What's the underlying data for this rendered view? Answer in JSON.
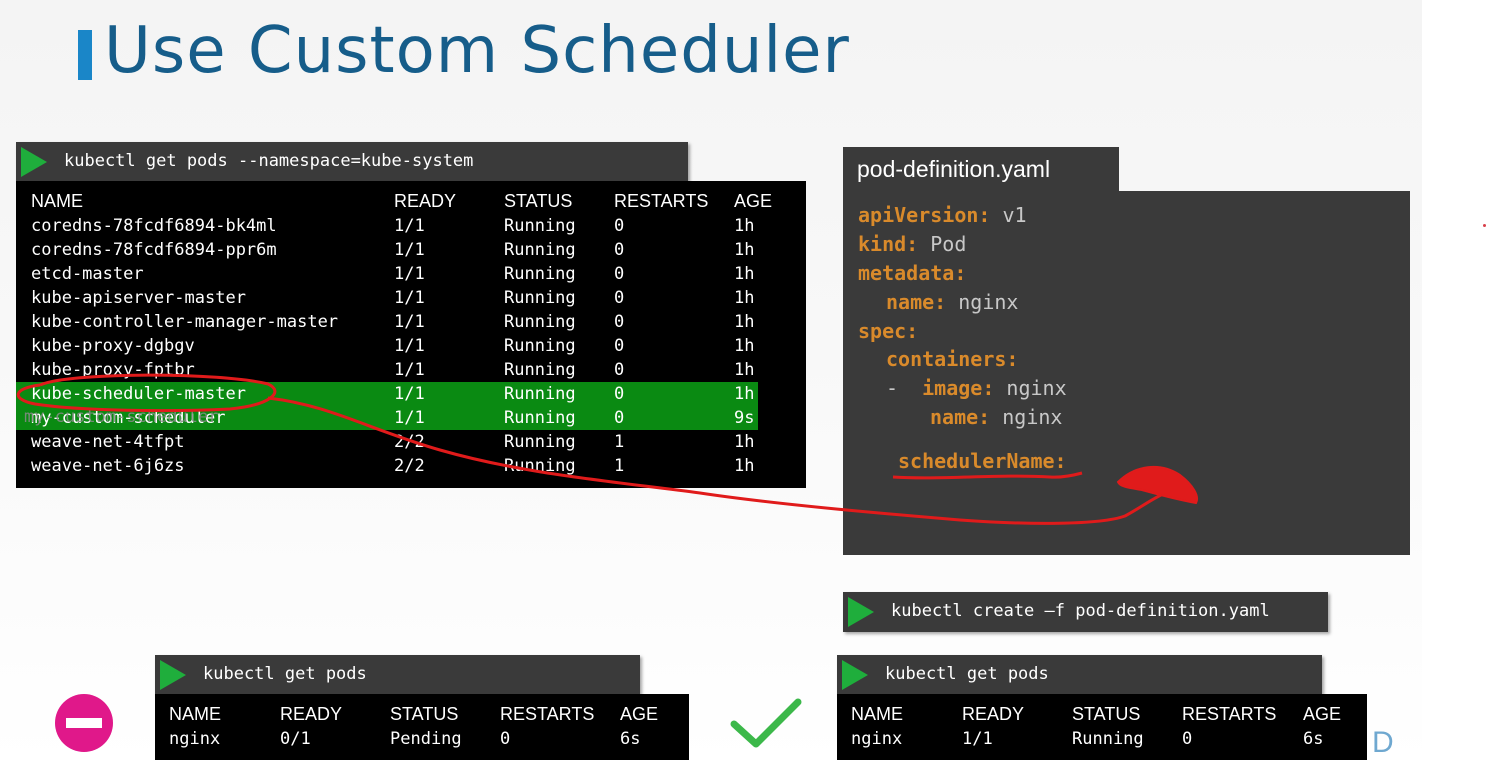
{
  "slide": {
    "title": "Use Custom Scheduler",
    "brand_fragment": "D"
  },
  "top_terminal": {
    "command": "kubectl get pods --namespace=kube-system",
    "headers": [
      "NAME",
      "READY",
      "STATUS",
      "RESTARTS",
      "AGE"
    ],
    "rows": [
      [
        "coredns-78fcdf6894-bk4ml",
        "1/1",
        "Running",
        "0",
        "1h"
      ],
      [
        "coredns-78fcdf6894-ppr6m",
        "1/1",
        "Running",
        "0",
        "1h"
      ],
      [
        "etcd-master",
        "1/1",
        "Running",
        "0",
        "1h"
      ],
      [
        "kube-apiserver-master",
        "1/1",
        "Running",
        "0",
        "1h"
      ],
      [
        "kube-controller-manager-master",
        "1/1",
        "Running",
        "0",
        "1h"
      ],
      [
        "kube-proxy-dgbgv",
        "1/1",
        "Running",
        "0",
        "1h"
      ],
      [
        "kube-proxy-fptbr",
        "1/1",
        "Running",
        "0",
        "1h"
      ],
      [
        "kube-scheduler-master",
        "1/1",
        "Running",
        "0",
        "1h"
      ],
      [
        "my-custom-scheduler",
        "1/1",
        "Running",
        "0",
        "9s"
      ],
      [
        "weave-net-4tfpt",
        "2/2",
        "Running",
        "1",
        "1h"
      ],
      [
        "weave-net-6j6zs",
        "2/2",
        "Running",
        "1",
        "1h"
      ]
    ],
    "highlighted_rows": [
      7,
      8
    ],
    "highlight_color": "#0a8a12",
    "overlay_text": "my-custom-scheduler"
  },
  "yaml": {
    "filename": "pod-definition.yaml",
    "lines": {
      "l1": {
        "key": "apiVersion:",
        "value": " v1"
      },
      "l2": {
        "key": "kind:",
        "value": " Pod"
      },
      "l3": {
        "key": "metadata:",
        "value": ""
      },
      "l4": {
        "key": "name:",
        "value": " nginx"
      },
      "l5": {
        "key": "spec:",
        "value": ""
      },
      "l6": {
        "key": "containers:",
        "value": ""
      },
      "l7": {
        "dash": "-",
        "key": "image:",
        "value": " nginx"
      },
      "l8": {
        "key": "name:",
        "value": " nginx"
      },
      "l9": {
        "key": "schedulerName:",
        "value": ""
      }
    },
    "key_color": "#d98a2b"
  },
  "create_command": {
    "command": "kubectl create –f pod-definition.yaml"
  },
  "pending_result": {
    "command": "kubectl get pods",
    "headers": [
      "NAME",
      "READY",
      "STATUS",
      "RESTARTS",
      "AGE"
    ],
    "row": [
      "nginx",
      "0/1",
      "Pending",
      "0",
      "6s"
    ],
    "icon": "no-entry-icon",
    "icon_color": "#e0188a"
  },
  "running_result": {
    "command": "kubectl get pods",
    "headers": [
      "NAME",
      "READY",
      "STATUS",
      "RESTARTS",
      "AGE"
    ],
    "row": [
      "nginx",
      "1/1",
      "Running",
      "0",
      "6s"
    ],
    "icon": "checkmark-icon",
    "icon_color": "#3cb84a"
  },
  "colors": {
    "title": "#165d8a",
    "title_bar": "#1a86c8",
    "terminal_bg": "#000000",
    "command_bar_bg": "#3a3a3a",
    "play_icon": "#1fae3c",
    "annotation": "#e01b1b"
  }
}
